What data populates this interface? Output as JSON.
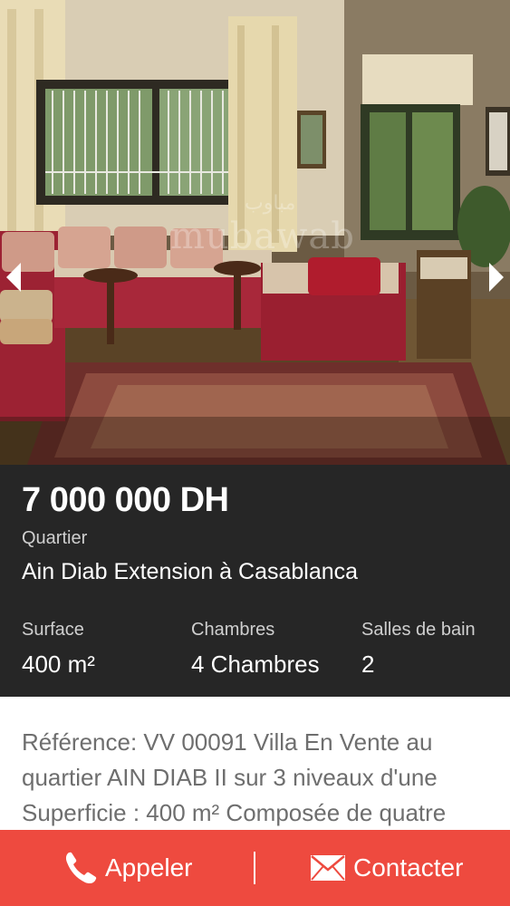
{
  "photo": {
    "watermark": "mubawab",
    "watermark_ar": "مباوب",
    "prev_icon": "chevron-left-icon",
    "next_icon": "chevron-right-icon"
  },
  "listing": {
    "price": "7 000 000 DH",
    "quartier_label": "Quartier",
    "quartier_value": "Ain Diab Extension à Casablanca",
    "surface_label": "Surface",
    "surface_value": "400 m²",
    "chambres_label": "Chambres",
    "chambres_value": "4 Chambres",
    "bain_label": "Salles de bain",
    "bain_value": "2"
  },
  "description": {
    "text": "Référence: VV 00091 Villa En Vente au quartier AIN DIAB II sur 3 niveaux d'une Superficie : 400 m² Composée de quatre"
  },
  "actions": {
    "call_label": "Appeler",
    "call_icon": "phone-icon",
    "contact_label": "Contacter",
    "contact_icon": "envelope-icon",
    "accent_color": "#ee4a3f"
  }
}
